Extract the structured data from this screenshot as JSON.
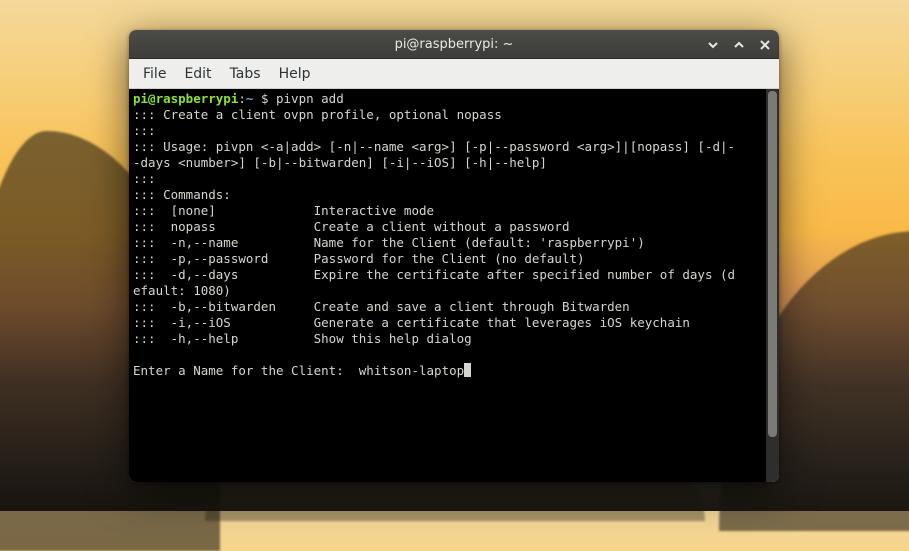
{
  "window": {
    "title": "pi@raspberrypi: ~"
  },
  "menu": {
    "file": "File",
    "edit": "Edit",
    "tabs": "Tabs",
    "help": "Help"
  },
  "prompt": {
    "user_host": "pi@raspberrypi",
    "sep1": ":",
    "cwd": "~",
    "sigil": " $ ",
    "command": "pivpn add"
  },
  "lines": {
    "l1": "::: Create a client ovpn profile, optional nopass",
    "l2": ":::",
    "l3": "::: Usage: pivpn <-a|add> [-n|--name <arg>] [-p|--password <arg>]|[nopass] [-d|--days <number>] [-b|--bitwarden] [-i|--iOS] [-h|--help]",
    "l4": ":::",
    "l5": "::: Commands:",
    "l6": ":::  [none]             Interactive mode",
    "l7": ":::  nopass             Create a client without a password",
    "l8": ":::  -n,--name          Name for the Client (default: 'raspberrypi')",
    "l9": ":::  -p,--password      Password for the Client (no default)",
    "l10": ":::  -d,--days          Expire the certificate after specified number of days (default: 1080)",
    "l11": ":::  -b,--bitwarden     Create and save a client through Bitwarden",
    "l12": ":::  -i,--iOS           Generate a certificate that leverages iOS keychain",
    "l13": ":::  -h,--help          Show this help dialog",
    "blank": "",
    "prompt2": "Enter a Name for the Client:  ",
    "input": "whitson-laptop"
  }
}
